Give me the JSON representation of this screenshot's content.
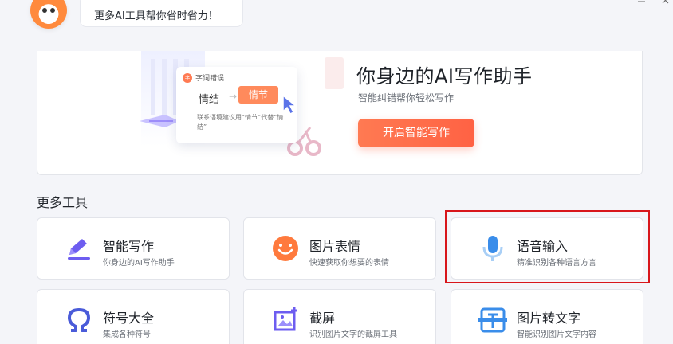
{
  "assistant": {
    "message": "更多AI工具帮你省时省力！"
  },
  "hero": {
    "title": "你身边的AI写作助手",
    "subtitle": "智能纠错帮你轻松写作",
    "button_label": "开启智能写作",
    "tip_card": {
      "header": "字词错误",
      "badge": "字",
      "wrong_word": "情结",
      "arrow": "→",
      "suggestion": "情节",
      "note": "联系语境建议用“情节”代替“情结”"
    }
  },
  "tools_section": {
    "title": "更多工具",
    "tools": [
      {
        "name": "智能写作",
        "desc": "你身边的AI写作助手",
        "icon": "pen-icon"
      },
      {
        "name": "图片表情",
        "desc": "快速获取你想要的表情",
        "icon": "smiley-icon"
      },
      {
        "name": "语音输入",
        "desc": "精准识别各种语言方言",
        "icon": "microphone-icon"
      },
      {
        "name": "符号大全",
        "desc": "集成各种符号",
        "icon": "omega-icon"
      },
      {
        "name": "截屏",
        "desc": "识别图片文字的截屏工具",
        "icon": "screenshot-icon"
      },
      {
        "name": "图片转文字",
        "desc": "智能识别图片文字内容",
        "icon": "image-to-text-icon"
      }
    ]
  },
  "colors": {
    "accent": "#ff6a48",
    "highlight_border": "#d8161b"
  }
}
